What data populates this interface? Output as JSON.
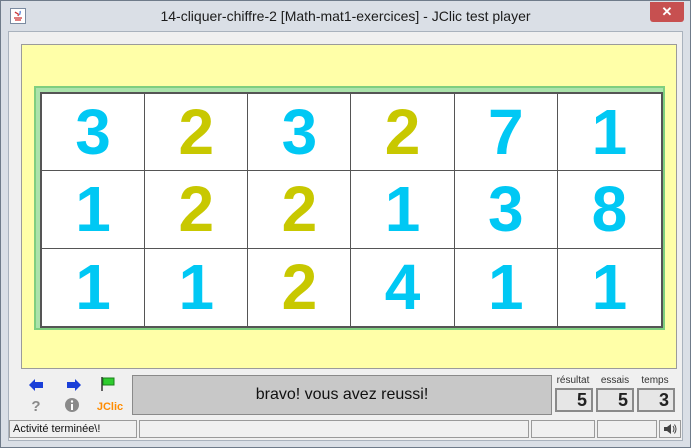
{
  "window": {
    "title": "14-cliquer-chiffre-2 [Math-mat1-exercices] - JClic test player",
    "close_label": "✕"
  },
  "colors": {
    "cyan_digit": "#00c8f4",
    "olive_digit": "#c8c800",
    "play_bg": "#ffffa8",
    "grid_border": "#abe3ab"
  },
  "grid": {
    "cells": [
      {
        "digit": "3",
        "color": "#00c8f4"
      },
      {
        "digit": "2",
        "color": "#c8c800"
      },
      {
        "digit": "3",
        "color": "#00c8f4"
      },
      {
        "digit": "2",
        "color": "#c8c800"
      },
      {
        "digit": "7",
        "color": "#00c8f4"
      },
      {
        "digit": "1",
        "color": "#00c8f4"
      },
      {
        "digit": "1",
        "color": "#00c8f4"
      },
      {
        "digit": "2",
        "color": "#c8c800"
      },
      {
        "digit": "2",
        "color": "#c8c800"
      },
      {
        "digit": "1",
        "color": "#00c8f4"
      },
      {
        "digit": "3",
        "color": "#00c8f4"
      },
      {
        "digit": "8",
        "color": "#00c8f4"
      },
      {
        "digit": "1",
        "color": "#00c8f4"
      },
      {
        "digit": "1",
        "color": "#00c8f4"
      },
      {
        "digit": "2",
        "color": "#c8c800"
      },
      {
        "digit": "4",
        "color": "#00c8f4"
      },
      {
        "digit": "1",
        "color": "#00c8f4"
      },
      {
        "digit": "1",
        "color": "#00c8f4"
      }
    ]
  },
  "toolbar": {
    "prev_icon": "arrow-left-icon",
    "next_icon": "arrow-right-icon",
    "restart_icon": "green-flag-icon",
    "help_icon": "question-icon",
    "info_icon": "info-icon",
    "jclic_label": "JClic"
  },
  "message": "bravo! vous avez reussi!",
  "counters": {
    "result_label": "résultat",
    "result_value": "5",
    "tries_label": "essais",
    "tries_value": "5",
    "time_label": "temps",
    "time_value": "3"
  },
  "status": {
    "text": "Activité terminée\\!",
    "sound_icon": "speaker-icon"
  }
}
